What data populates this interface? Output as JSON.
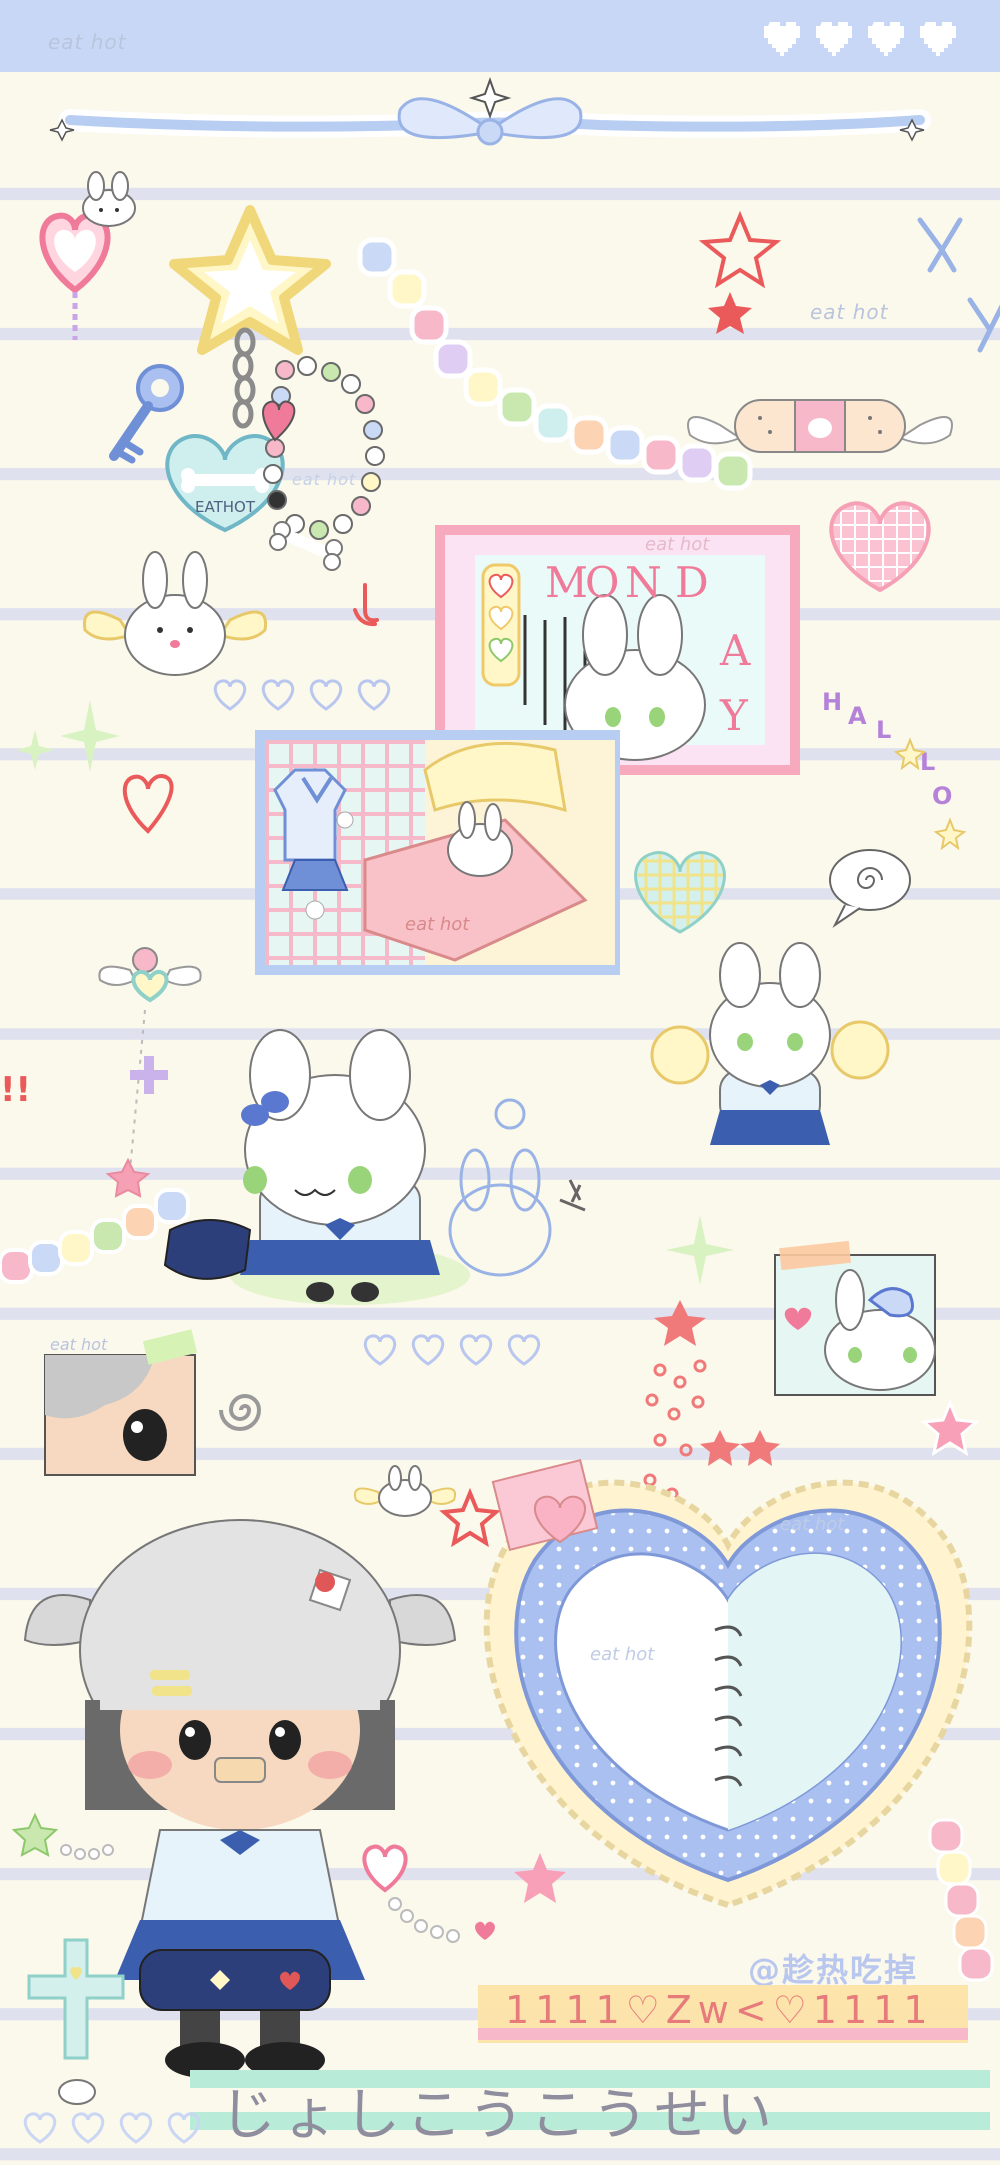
{
  "watermarks": {
    "top_left": "eat hot",
    "mid_right": "eat hot",
    "frame_top": "eat hot",
    "bed_blanket": "eat hot",
    "portrait": "eat hot",
    "heart_mirror_top": "eat hot",
    "heart_mirror_mid": "eat hot",
    "keychain": "eat hot"
  },
  "keychain_tag": "EATHOT",
  "monday_letters": [
    "M",
    "O",
    "N",
    "D",
    "A",
    "Y"
  ],
  "hallo_letters": [
    "H",
    "A",
    "L",
    "L",
    "O"
  ],
  "exclaim": "!!",
  "artist_handle": "@趁热吃掉",
  "tape_text": "1111♡Zw<♡1111",
  "bottom_kana": "じょしこうこうせい",
  "colors": {
    "background": "#fbf8ec",
    "topbar": "#c9d7f6",
    "line": "#dfe2ee",
    "pink": "#f4a6b8",
    "blue": "#a9c0f0",
    "cream": "#fff7d6"
  }
}
